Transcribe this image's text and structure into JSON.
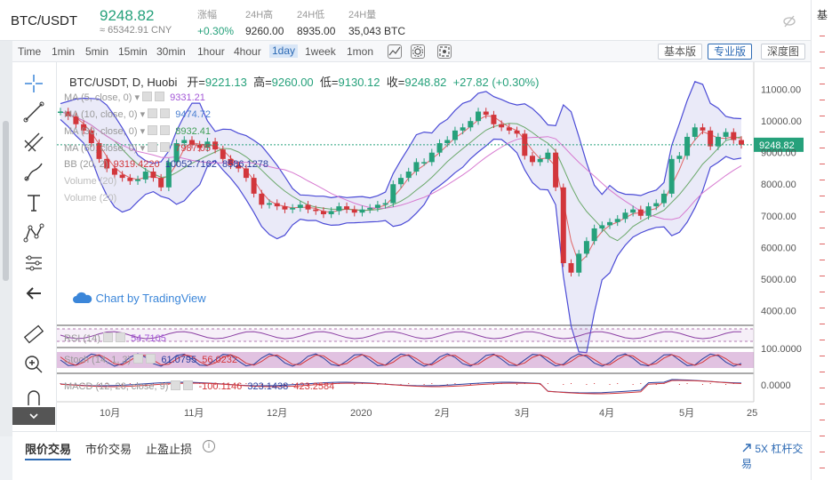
{
  "ticker": {
    "symbol": "BTC/USDT",
    "price": "9248.82",
    "price_cny": "≈ 65342.91 CNY",
    "stats": [
      {
        "label": "涨幅",
        "value": "+0.30%",
        "up": true
      },
      {
        "label": "24H高",
        "value": "9260.00",
        "up": false
      },
      {
        "label": "24H低",
        "value": "8935.00",
        "up": false
      },
      {
        "label": "24H量",
        "value": "35,043 BTC",
        "up": false
      }
    ],
    "right_label": "基"
  },
  "toolbar": {
    "intervals": [
      "Time",
      "1min",
      "5min",
      "15min",
      "30min",
      "1hour",
      "4hour",
      "1day",
      "1week",
      "1mon"
    ],
    "active_interval": "1day",
    "views": [
      "基本版",
      "专业版",
      "深度图"
    ],
    "active_view": "专业版"
  },
  "chart": {
    "header": {
      "pair": "BTC/USDT, D, Huobi",
      "open_label": "开",
      "open": "9221.13",
      "high_label": "高",
      "high": "9260.00",
      "low_label": "低",
      "low": "9130.12",
      "close_label": "收",
      "close": "9248.82",
      "change": "+27.82 (+0.30%)"
    },
    "indicators": [
      {
        "label": "MA (5, close, 0)",
        "value": "9331.21",
        "color": "#a357d7"
      },
      {
        "label": "MA (10, close, 0)",
        "value": "9474.72",
        "color": "#4a7fd1"
      },
      {
        "label": "MA (30, close, 0)",
        "value": "8932.41",
        "color": "#3e9e55"
      },
      {
        "label": "MA (60, close, 0)",
        "value": "7987.05",
        "color": "#d2363b"
      }
    ],
    "bb": {
      "label": "BB (20, 2)",
      "v1": "9319.4220",
      "v2": "10052.7162",
      "v3": "8586.1278"
    },
    "volume_labels": [
      "Volume (20)",
      "Volume (20)"
    ],
    "watermark": "Chart by TradingView",
    "current_price_tag": "9248.82",
    "y_ticks": [
      "11000.00",
      "10000.00",
      "9000.00",
      "8000.00",
      "7000.00",
      "6000.00",
      "5000.00",
      "4000.00"
    ],
    "x_ticks": [
      "10月",
      "11月",
      "12月",
      "2020",
      "2月",
      "3月",
      "4月",
      "5月",
      "25"
    ],
    "rsi": {
      "label": "RSI (14)",
      "value": "54.7105"
    },
    "stoch": {
      "label": "Stoch (14, 1, 3)",
      "v1": "61.0795",
      "v2": "56.0232"
    },
    "stoch_tick": "100.0000",
    "macd": {
      "label": "MACD (12, 26, close, 9)",
      "v1": "-100.1146",
      "v2": "323.1438",
      "v3": "423.2584"
    },
    "macd_tick": "0.0000"
  },
  "chart_data": {
    "type": "candlestick",
    "title": "BTC/USDT, D, Huobi",
    "ylim": [
      3700,
      11300
    ],
    "x_labels": [
      "10月",
      "11月",
      "12月",
      "2020",
      "2月",
      "3月",
      "4月",
      "5月",
      "25"
    ],
    "close_series": [
      10300,
      10150,
      9900,
      9700,
      9300,
      8800,
      8500,
      8300,
      8200,
      8100,
      8150,
      8400,
      8200,
      7900,
      8700,
      9300,
      9400,
      9250,
      9150,
      9350,
      9100,
      8800,
      8600,
      8500,
      8200,
      7700,
      7350,
      7400,
      7300,
      7200,
      7250,
      7350,
      7200,
      7150,
      7050,
      7150,
      7300,
      7200,
      7100,
      7200,
      7250,
      7350,
      7400,
      8000,
      8200,
      8400,
      8700,
      8700,
      9000,
      9300,
      9400,
      9700,
      9800,
      10000,
      10300,
      10200,
      9900,
      9800,
      9700,
      9600,
      8900,
      8700,
      8800,
      9000,
      7900,
      5500,
      5200,
      5800,
      6200,
      6600,
      6700,
      6800,
      6900,
      7100,
      7200,
      7000,
      7300,
      7400,
      7700,
      8800,
      8900,
      9500,
      9800,
      9700,
      9200,
      9500,
      9650,
      9400,
      9248.82
    ],
    "current": 9248.82
  }
}
